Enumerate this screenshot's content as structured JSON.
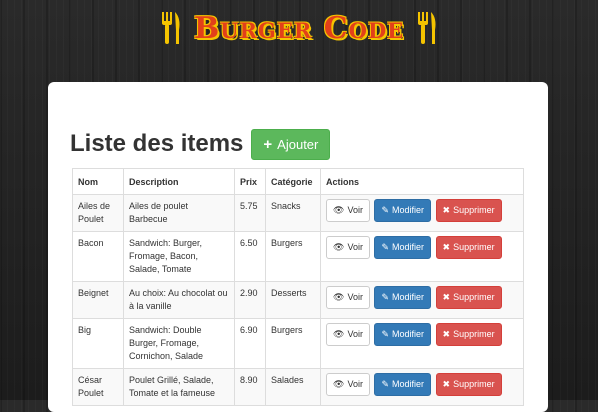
{
  "brand": {
    "name": "Burger Code"
  },
  "page": {
    "title": "Liste des items",
    "add_button": "Ajouter"
  },
  "table": {
    "headers": [
      "Nom",
      "Description",
      "Prix",
      "Catégorie",
      "Actions"
    ],
    "rows": [
      {
        "nom": "Ailes de Poulet",
        "description": "Ailes de poulet Barbecue",
        "prix": "5.75",
        "categorie": "Snacks"
      },
      {
        "nom": "Bacon",
        "description": "Sandwich: Burger, Fromage, Bacon, Salade, Tomate",
        "prix": "6.50",
        "categorie": "Burgers"
      },
      {
        "nom": "Beignet",
        "description": "Au choix: Au chocolat ou à la vanille",
        "prix": "2.90",
        "categorie": "Desserts"
      },
      {
        "nom": "Big",
        "description": "Sandwich: Double Burger, Fromage, Cornichon, Salade",
        "prix": "6.90",
        "categorie": "Burgers"
      },
      {
        "nom": "César Poulet",
        "description": "Poulet Grillé, Salade, Tomate et la fameuse",
        "prix": "8.90",
        "categorie": "Salades"
      }
    ],
    "actions": {
      "view": "Voir",
      "edit": "Modifier",
      "delete": "Supprimer"
    }
  },
  "colors": {
    "success": "#5cb85c",
    "primary": "#337ab7",
    "danger": "#d9534f",
    "brand_red": "#e2401a",
    "brand_yellow": "#f5c400"
  }
}
